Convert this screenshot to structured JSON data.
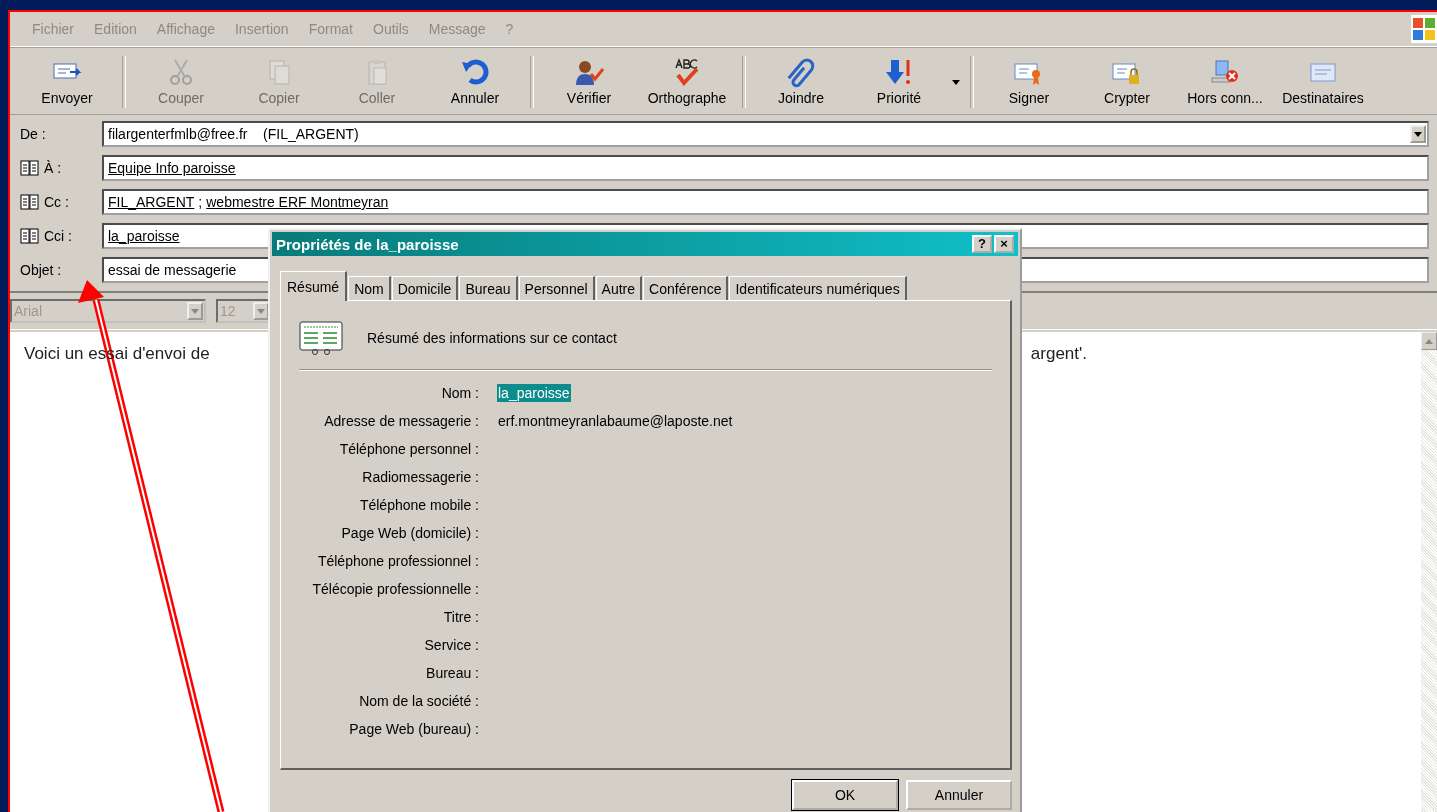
{
  "menu": [
    "Fichier",
    "Edition",
    "Affichage",
    "Insertion",
    "Format",
    "Outils",
    "Message",
    "?"
  ],
  "toolbar": [
    {
      "kind": "button",
      "label": "Envoyer",
      "disabled": false
    },
    {
      "kind": "separator"
    },
    {
      "kind": "button",
      "label": "Couper",
      "disabled": true
    },
    {
      "kind": "button",
      "label": "Copier",
      "disabled": true
    },
    {
      "kind": "button",
      "label": "Coller",
      "disabled": true
    },
    {
      "kind": "button",
      "label": "Annuler",
      "disabled": false
    },
    {
      "kind": "separator"
    },
    {
      "kind": "button",
      "label": "Vérifier",
      "disabled": false
    },
    {
      "kind": "button",
      "label": "Orthographe",
      "disabled": false
    },
    {
      "kind": "separator"
    },
    {
      "kind": "button",
      "label": "Joindre",
      "disabled": false
    },
    {
      "kind": "button",
      "label": "Priorité",
      "disabled": false
    },
    {
      "kind": "dropdown"
    },
    {
      "kind": "separator"
    },
    {
      "kind": "button",
      "label": "Signer",
      "disabled": false
    },
    {
      "kind": "button",
      "label": "Crypter",
      "disabled": false
    },
    {
      "kind": "button",
      "label": "Hors conn...",
      "disabled": false
    },
    {
      "kind": "button",
      "label": "Destinataires",
      "disabled": false
    }
  ],
  "header_fields": [
    {
      "kind": "dropdown",
      "label": "De :",
      "value": "filargenterfmlb@free.fr    (FIL_ARGENT)"
    },
    {
      "kind": "recipients",
      "label": "À :",
      "recipients": [
        "Equipe Info paroisse"
      ]
    },
    {
      "kind": "recipients",
      "label": "Cc :",
      "recipients": [
        "FIL_ARGENT",
        "webmestre ERF Montmeyran"
      ],
      "separator": ";"
    },
    {
      "kind": "recipients",
      "label": "Cci :",
      "recipients": [
        "la_paroisse"
      ]
    },
    {
      "kind": "text",
      "label": "Objet :",
      "value": "essai de messagerie"
    }
  ],
  "format_bar": {
    "font": "Arial",
    "size": "12"
  },
  "body_fragments": [
    "Voici un essai d'envoi de",
    "argent'."
  ],
  "dialog": {
    "title": "Propriétés de la_paroisse",
    "help": "?",
    "close": "×",
    "tabs": [
      {
        "label": "Résumé",
        "selected": true
      },
      {
        "label": "Nom",
        "selected": false
      },
      {
        "label": "Domicile",
        "selected": false
      },
      {
        "label": "Bureau",
        "selected": false
      },
      {
        "label": "Personnel",
        "selected": false
      },
      {
        "label": "Autre",
        "selected": false
      },
      {
        "label": "Conférence",
        "selected": false
      },
      {
        "label": "Identificateurs numériques",
        "selected": false
      }
    ],
    "header": "Résumé des informations sur ce contact",
    "fields": [
      {
        "label": "Nom :",
        "value": "la_paroisse",
        "highlighted": true
      },
      {
        "label": "Adresse de messagerie :",
        "value": "erf.montmeyranlabaume@laposte.net",
        "highlighted": false
      },
      {
        "label": "Téléphone personnel :"
      },
      {
        "label": "Radiomessagerie :"
      },
      {
        "label": "Téléphone mobile :"
      },
      {
        "label": "Page Web (domicile) :"
      },
      {
        "label": "Téléphone professionnel :"
      },
      {
        "label": "Télécopie professionnelle :"
      },
      {
        "label": "Titre :"
      },
      {
        "label": "Service :"
      },
      {
        "label": "Bureau :"
      },
      {
        "label": "Nom de la société :"
      },
      {
        "label": "Page Web (bureau) :"
      }
    ],
    "buttons": [
      "OK",
      "Annuler"
    ]
  }
}
